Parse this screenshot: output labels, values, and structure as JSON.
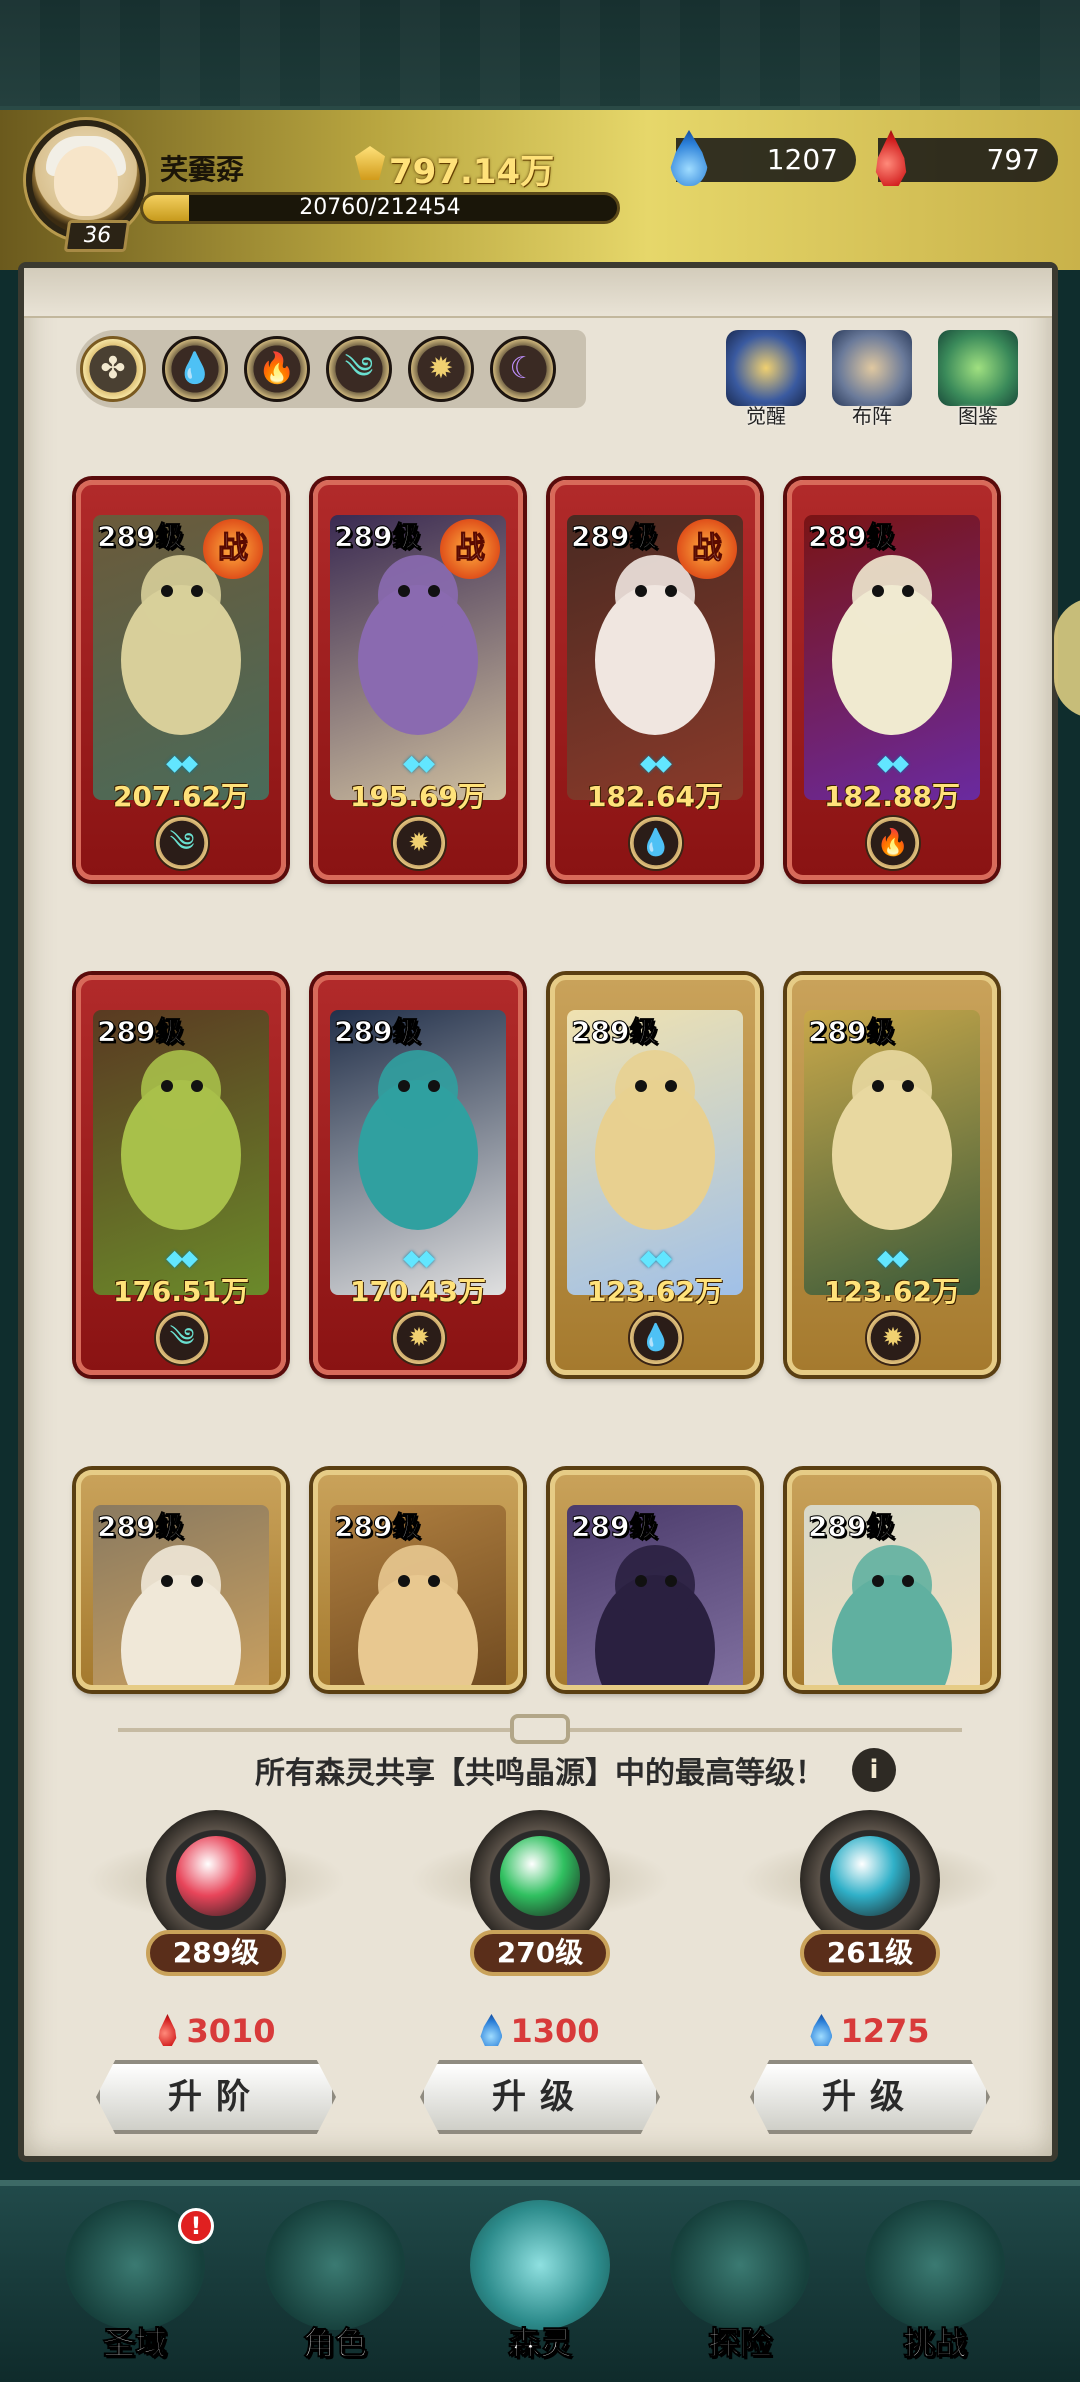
{
  "player": {
    "name": "芺嫑孬",
    "level": "36",
    "gold": "797.14万",
    "exp_text": "20760/212454",
    "exp_fraction": 0.0977
  },
  "resources": {
    "mana": "1207",
    "blood": "797"
  },
  "filters": [
    {
      "name": "all",
      "icon": "four-leaf-icon",
      "glyph": "✤"
    },
    {
      "name": "water",
      "icon": "water-drop-icon",
      "glyph": "💧"
    },
    {
      "name": "fire",
      "icon": "flame-icon",
      "glyph": "🔥"
    },
    {
      "name": "wind",
      "icon": "wind-icon",
      "glyph": "༄"
    },
    {
      "name": "light",
      "icon": "sun-icon",
      "glyph": "✹"
    },
    {
      "name": "dark",
      "icon": "moon-icon",
      "glyph": "☾"
    }
  ],
  "top_actions": {
    "awaken": "觉醒",
    "formation": "布阵",
    "codex": "图鉴"
  },
  "cards": [
    {
      "level": "289级",
      "power": "207.62万",
      "in_battle": "战",
      "frame": "red",
      "element": "wind",
      "art": [
        "#6b5a3a",
        "#d8cf9a",
        "#4a6b5a"
      ]
    },
    {
      "level": "289级",
      "power": "195.69万",
      "in_battle": "战",
      "frame": "red",
      "element": "light",
      "art": [
        "#3a2a52",
        "#8a6ab0",
        "#d0c0a0"
      ]
    },
    {
      "level": "289级",
      "power": "182.64万",
      "in_battle": "战",
      "frame": "red",
      "element": "water",
      "art": [
        "#4a2a22",
        "#f0e6e0",
        "#8a3a2a"
      ]
    },
    {
      "level": "289级",
      "power": "182.88万",
      "in_battle": "",
      "frame": "red",
      "element": "fire",
      "art": [
        "#7a1414",
        "#f0ead0",
        "#6a2aa0"
      ]
    },
    {
      "level": "289级",
      "power": "176.51万",
      "in_battle": "",
      "frame": "red",
      "element": "wind",
      "art": [
        "#5a3a22",
        "#a8c04a",
        "#6b8a2a"
      ]
    },
    {
      "level": "289级",
      "power": "170.43万",
      "in_battle": "",
      "frame": "red",
      "element": "light",
      "art": [
        "#22304a",
        "#30a0a0",
        "#e0e0e0"
      ]
    },
    {
      "level": "289级",
      "power": "123.62万",
      "in_battle": "",
      "frame": "gold",
      "element": "water",
      "art": [
        "#f0e2b0",
        "#e8d090",
        "#a0c0e8"
      ]
    },
    {
      "level": "289级",
      "power": "123.62万",
      "in_battle": "",
      "frame": "gold",
      "element": "light",
      "art": [
        "#c9a84a",
        "#e8d8a0",
        "#3a5a3a"
      ]
    },
    {
      "level": "289级",
      "power": "",
      "in_battle": "",
      "frame": "gold",
      "element": "",
      "art": [
        "#8a7a60",
        "#f0e8d8",
        "#c9a060"
      ]
    },
    {
      "level": "289级",
      "power": "",
      "in_battle": "",
      "frame": "gold",
      "element": "",
      "art": [
        "#b08040",
        "#e8c890",
        "#704a20"
      ]
    },
    {
      "level": "289级",
      "power": "",
      "in_battle": "",
      "frame": "gold",
      "element": "",
      "art": [
        "#4a3a6a",
        "#2a2040",
        "#8070a0"
      ]
    },
    {
      "level": "289级",
      "power": "",
      "in_battle": "",
      "frame": "gold",
      "element": "",
      "art": [
        "#d8d8c8",
        "#60b0a0",
        "#f0e0c0"
      ]
    }
  ],
  "resonance": {
    "text": "所有森灵共享【共鸣晶源】中的最高等级！",
    "info": "i",
    "orbs": [
      {
        "level": "289级",
        "cost": "3010",
        "cost_icon": "blood-drop-icon",
        "button": "升阶",
        "color": "#e8455a"
      },
      {
        "level": "270级",
        "cost": "1300",
        "cost_icon": "mana-flame-icon",
        "button": "升级",
        "color": "#30c060"
      },
      {
        "level": "261级",
        "cost": "1275",
        "cost_icon": "mana-flame-icon",
        "button": "升级",
        "color": "#30b0c8"
      }
    ]
  },
  "nav": [
    {
      "label": "圣域",
      "icon": "tree-icon",
      "badge": "!",
      "active": false
    },
    {
      "label": "角色",
      "icon": "character-icon",
      "badge": "",
      "active": false
    },
    {
      "label": "森灵",
      "icon": "spirit-icon",
      "badge": "",
      "active": true
    },
    {
      "label": "探险",
      "icon": "shield-icon",
      "badge": "",
      "active": false
    },
    {
      "label": "挑战",
      "icon": "sword-icon",
      "badge": "",
      "active": false
    }
  ]
}
